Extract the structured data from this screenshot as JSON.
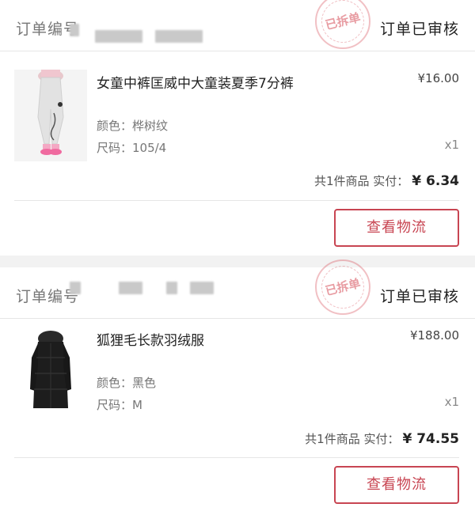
{
  "colors": {
    "accent": "#c84552",
    "stamp": "#d64a56"
  },
  "orders": [
    {
      "header_label": "订单编号",
      "status": "订单已审核",
      "stamp_text": "已拆单",
      "product": {
        "title": "女童中裤匡威中大童装夏季7分裤",
        "price": "¥16.00",
        "color": "颜色：桦树纹",
        "size": "尺码：105/4",
        "qty": "x1",
        "image_icon": "girls-pants-image"
      },
      "total_prefix": "共1件商品  实付：",
      "total_amount": "¥ 6.34",
      "button": "查看物流"
    },
    {
      "header_label": "订单编号",
      "status": "订单已审核",
      "stamp_text": "已拆单",
      "product": {
        "title": "狐狸毛长款羽绒服",
        "price": "¥188.00",
        "color": "颜色：黑色",
        "size": "尺码：M",
        "qty": "x1",
        "image_icon": "black-down-coat-image"
      },
      "total_prefix": "共1件商品  实付：",
      "total_amount": "¥ 74.55",
      "button": "查看物流"
    }
  ]
}
